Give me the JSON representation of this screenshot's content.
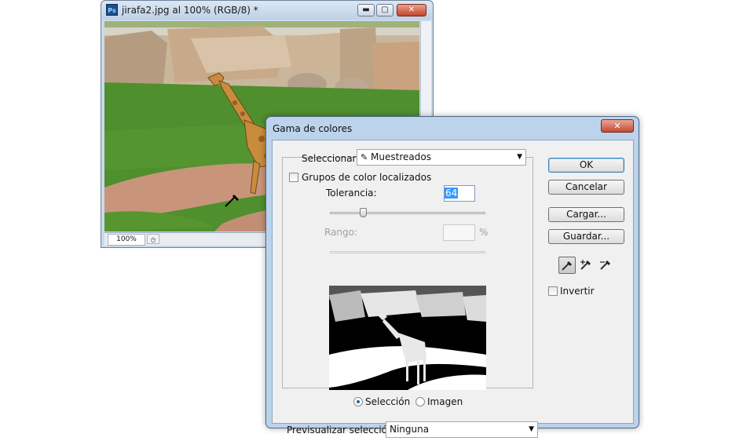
{
  "doc_window": {
    "title": "jirafa2.jpg al 100% (RGB/8) *",
    "app_icon_text": "Ps",
    "zoom": "100%",
    "buttons": {
      "minimize": "▬",
      "maximize": "▢",
      "close": "✕"
    }
  },
  "dialog": {
    "title": "Gama de colores",
    "close_glyph": "✕",
    "select_label": "Seleccionar:",
    "select_value": "Muestreados",
    "localized_label": "Grupos de color localizados",
    "tolerance_label": "Tolerancia:",
    "tolerance_value": "64",
    "tolerance_level": 0.64,
    "range_label": "Rango:",
    "range_value": "",
    "range_unit": "%",
    "view_options": {
      "selection": "Selección",
      "image": "Imagen"
    },
    "preview_label": "Previsualizar selección:",
    "preview_value": "Ninguna",
    "buttons": {
      "ok": "OK",
      "cancel": "Cancelar",
      "load": "Cargar...",
      "save": "Guardar..."
    },
    "invert_label": "Invertir",
    "eyedroppers": [
      "eyedropper-icon",
      "eyedropper-plus-icon",
      "eyedropper-minus-icon"
    ]
  },
  "colors": {
    "title_bar": "#bcd3ec",
    "dialog_bg": "#f0f0f0",
    "close_red": "#c34a33",
    "selection_blue": "#3399ff"
  }
}
